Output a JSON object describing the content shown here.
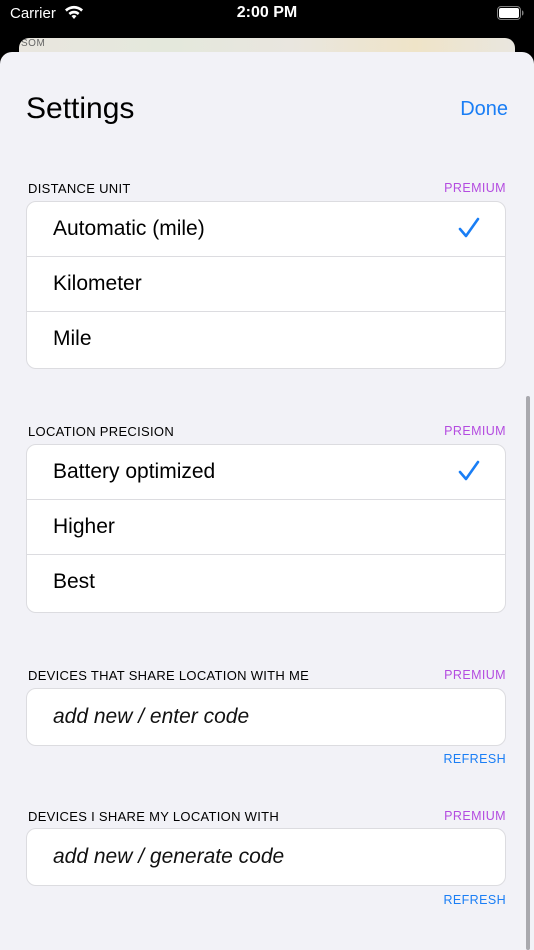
{
  "status_bar": {
    "carrier": "Carrier",
    "time": "2:00 PM"
  },
  "map": {
    "label": "SOM"
  },
  "header": {
    "title": "Settings",
    "done_label": "Done"
  },
  "distance_unit": {
    "label": "DISTANCE UNIT",
    "badge": "PREMIUM",
    "options": [
      {
        "label": "Automatic (mile)",
        "selected": true
      },
      {
        "label": "Kilometer",
        "selected": false
      },
      {
        "label": "Mile",
        "selected": false
      }
    ]
  },
  "location_precision": {
    "label": "LOCATION PRECISION",
    "badge": "PREMIUM",
    "options": [
      {
        "label": "Battery optimized",
        "selected": true
      },
      {
        "label": "Higher",
        "selected": false
      },
      {
        "label": "Best",
        "selected": false
      }
    ]
  },
  "shared_with_me": {
    "label": "DEVICES THAT SHARE LOCATION WITH ME",
    "badge": "PREMIUM",
    "input_placeholder": "add new / enter code",
    "input_value": "",
    "refresh_label": "REFRESH"
  },
  "i_share_with": {
    "label": "DEVICES I SHARE MY LOCATION WITH",
    "badge": "PREMIUM",
    "input_placeholder": "add new / generate code",
    "input_value": "",
    "refresh_label": "REFRESH"
  },
  "colors": {
    "accent": "#1a7ef5",
    "premium": "#b44ce0",
    "background": "#f2f2f7"
  },
  "icons": [
    "wifi-icon",
    "battery-icon",
    "checkmark-icon"
  ]
}
